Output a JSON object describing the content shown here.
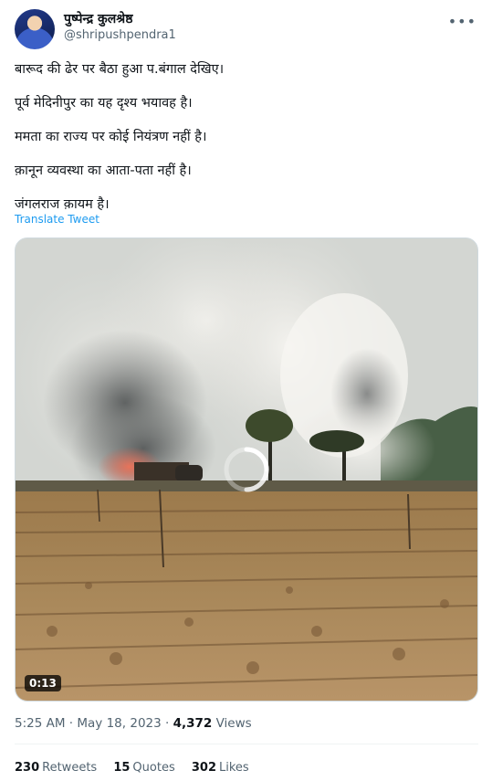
{
  "author": {
    "name": "पुष्पेन्द्र कुलश्रेष्ठ",
    "handle": "@shripushpendra1"
  },
  "menu_icon": "more-horizontal-icon",
  "tweet": {
    "lines": [
      "बारूद की ढेर पर बैठा हुआ प.बंगाल देखिए।",
      "पूर्व मेदिनीपुर का यह दृश्य भयावह है।",
      "ममता का राज्य पर कोई नियंत्रण नहीं है।",
      "क़ानून व्यवस्था का आता-पता नहीं है।",
      "जंगलराज क़ायम है।"
    ],
    "translate_label": "Translate Tweet"
  },
  "video": {
    "duration": "0:13",
    "loading_icon": "loading-spinner-icon"
  },
  "meta": {
    "time": "5:25 AM",
    "separator": "·",
    "date": "May 18, 2023",
    "views_count": "4,372",
    "views_label": "Views"
  },
  "stats": {
    "retweets_count": "230",
    "retweets_label": "Retweets",
    "quotes_count": "15",
    "quotes_label": "Quotes",
    "likes_count": "302",
    "likes_label": "Likes"
  },
  "colors": {
    "link": "#1d9bf0",
    "secondary_text": "#536471",
    "primary_text": "#0f1419"
  }
}
